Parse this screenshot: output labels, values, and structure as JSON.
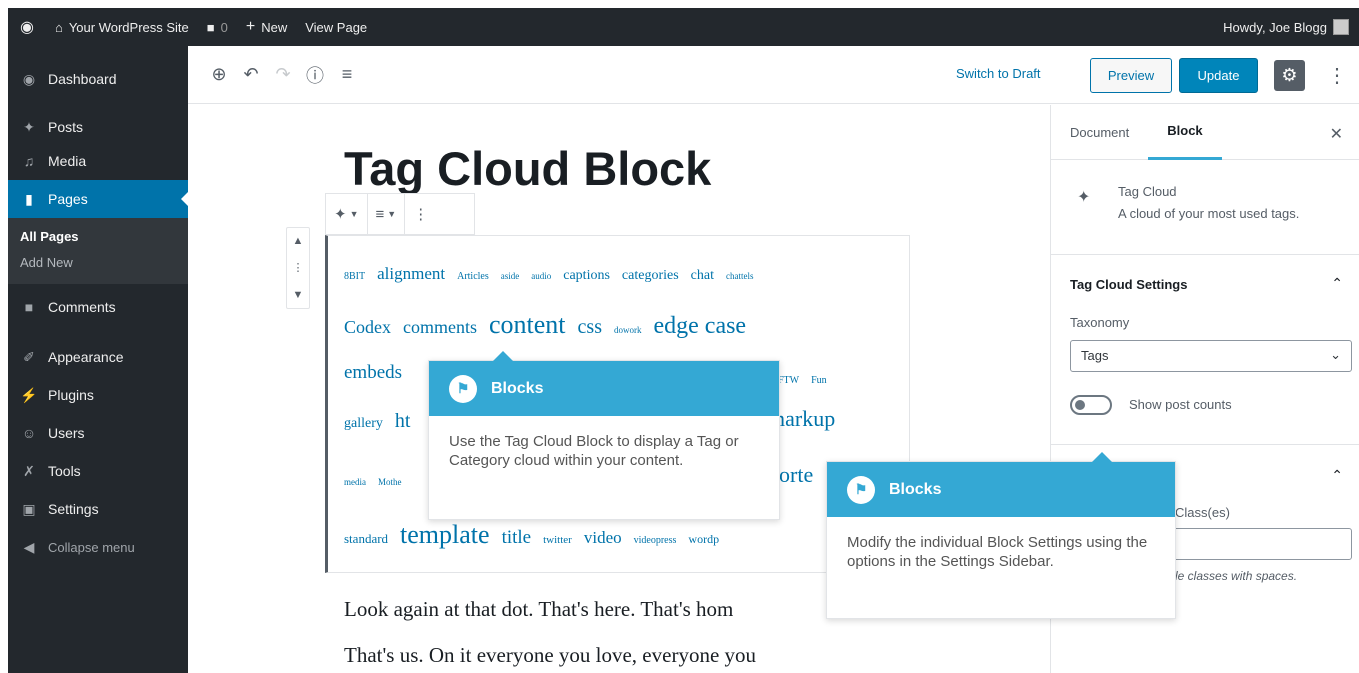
{
  "adminbar": {
    "wp_icon": "wordpress-logo",
    "site_name": "Your WordPress Site",
    "comments_count": "0",
    "new_label": "New",
    "view_page_label": "View Page",
    "howdy": "Howdy, Joe Blogg"
  },
  "sidebar": {
    "items": [
      {
        "label": "Dashboard",
        "icon": "dashboard-icon"
      },
      {
        "label": "Posts",
        "icon": "pin-icon"
      },
      {
        "label": "Media",
        "icon": "media-icon"
      },
      {
        "label": "Pages",
        "icon": "pages-icon"
      },
      {
        "label": "Comments",
        "icon": "comment-icon"
      },
      {
        "label": "Appearance",
        "icon": "brush-icon"
      },
      {
        "label": "Plugins",
        "icon": "plug-icon"
      },
      {
        "label": "Users",
        "icon": "users-icon"
      },
      {
        "label": "Tools",
        "icon": "wrench-icon"
      },
      {
        "label": "Settings",
        "icon": "settings-icon"
      },
      {
        "label": "Collapse menu",
        "icon": "collapse-icon"
      }
    ],
    "submenu": [
      "All Pages",
      "Add New"
    ]
  },
  "toolbar": {
    "switch_draft": "Switch to Draft",
    "preview": "Preview",
    "update": "Update"
  },
  "editor": {
    "title": "Tag Cloud Block",
    "tags_line1": [
      "8BIT",
      "alignment",
      "Articles",
      "aside",
      "audio",
      "captions",
      "categories",
      "chat",
      "chattels"
    ],
    "tags_line2": [
      "Codex",
      "comments",
      "content",
      "css",
      "dowork",
      "edge case"
    ],
    "tags_line3_left": "embeds",
    "tags_line3_right": [
      "FTW",
      "Fun"
    ],
    "tags_line4_left": [
      "gallery",
      "ht"
    ],
    "tags_line4_right": "markup",
    "tags_line5_left": [
      "media",
      "Mothe"
    ],
    "tags_line5_right": "horte",
    "tags_line6": [
      "standard",
      "template",
      "title",
      "twitter",
      "video",
      "videopress",
      "wordp"
    ],
    "body_line1": "Look again at that dot. That's here. That's hom",
    "body_line2": "That's us. On it everyone you love, everyone you"
  },
  "tooltip1": {
    "title": "Blocks",
    "body": "Use the Tag Cloud Block to display a Tag or Category cloud within your content."
  },
  "tooltip2": {
    "title": "Blocks",
    "body": "Modify the individual Block Settings using the options in the Settings Sidebar."
  },
  "settings": {
    "tab_document": "Document",
    "tab_block": "Block",
    "block_name": "Tag Cloud",
    "block_desc": "A cloud of your most used tags.",
    "panel_title": "Tag Cloud Settings",
    "taxonomy_label": "Taxonomy",
    "taxonomy_value": "Tags",
    "show_counts_label": "Show post counts",
    "css_class_label": "Class(es)",
    "css_help": "le classes with spaces."
  },
  "colors": {
    "accent": "#0073aa",
    "tip_header": "#34a8d4",
    "admin_dark": "#23282d"
  }
}
